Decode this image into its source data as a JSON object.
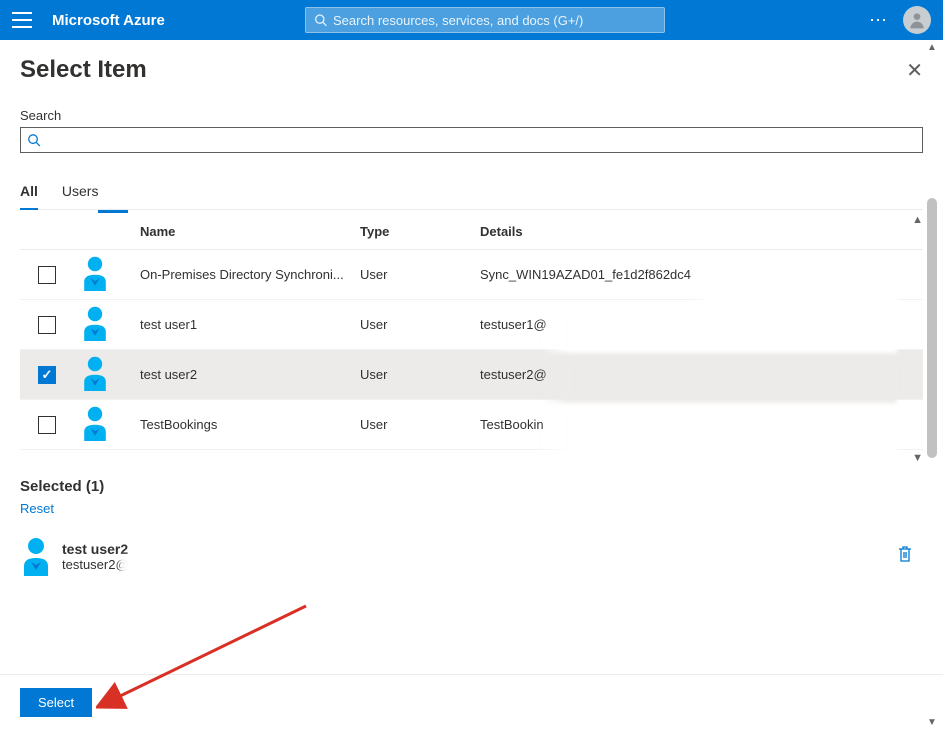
{
  "topbar": {
    "brand": "Microsoft Azure",
    "search_placeholder": "Search resources, services, and docs (G+/)"
  },
  "panel": {
    "title": "Select Item",
    "search_label": "Search"
  },
  "tabs": [
    {
      "label": "All",
      "active": true
    },
    {
      "label": "Users",
      "active": false
    }
  ],
  "columns": {
    "name": "Name",
    "type": "Type",
    "details": "Details"
  },
  "rows": [
    {
      "name": "On-Premises Directory Synchroni...",
      "type": "User",
      "details": "Sync_WIN19AZAD01_fe1d2f862dc4",
      "checked": false
    },
    {
      "name": "test user1",
      "type": "User",
      "details": "testuser1@",
      "checked": false
    },
    {
      "name": "test user2",
      "type": "User",
      "details": "testuser2@",
      "checked": true
    },
    {
      "name": "TestBookings",
      "type": "User",
      "details": "TestBookin",
      "checked": false
    }
  ],
  "selected": {
    "heading": "Selected (1)",
    "reset": "Reset",
    "item": {
      "name": "test user2",
      "details": "testuser2@"
    }
  },
  "footer": {
    "select": "Select"
  }
}
